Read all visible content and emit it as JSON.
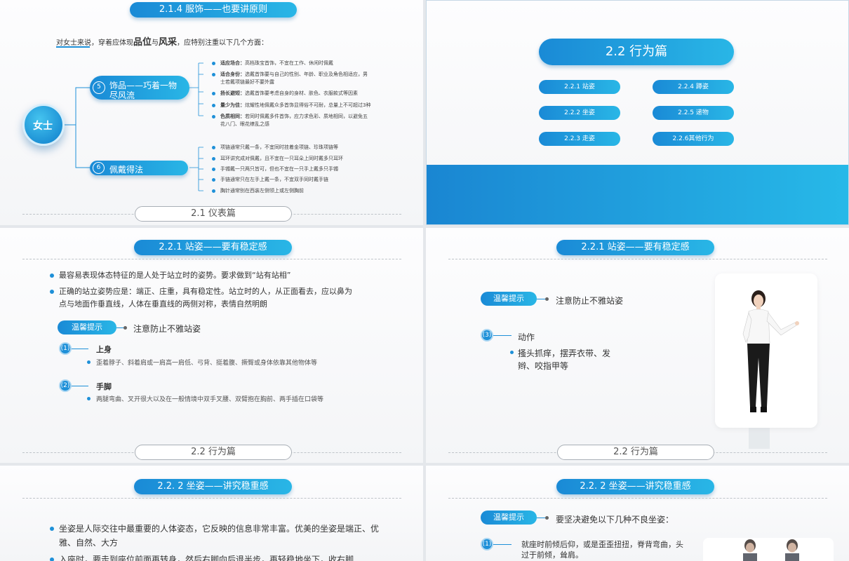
{
  "s1": {
    "title": "2.1.4  服饰——也要讲原则",
    "intro_prefix": "对女士来说，穿着应体现",
    "intro_b1": "品位",
    "intro_mid": "与",
    "intro_b2": "风采",
    "intro_suffix": "，应特别注重以下几个方面：",
    "center": "女士",
    "branch5_num": "5",
    "branch5_l1": "饰品——巧着一物",
    "branch5_l2": "尽风流",
    "branch6_num": "6",
    "branch6_label": "佩戴得法",
    "items_a": [
      {
        "b": "适应场合：",
        "t": "高档珠宝首饰，不宜在工作、休闲时佩戴"
      },
      {
        "b": "适合身份：",
        "t": "选戴首饰要与自己的性别、年龄、职业及角色相适应，男",
        "t2": "士若戴项链最好不要外露"
      },
      {
        "b": "扬长避短：",
        "t": "选戴首饰要考虑自身的身材、肤色、衣服款式等因素"
      },
      {
        "b": "量少为佳：",
        "t": "炫耀性地佩戴众多首饰显得俗不可耐，总量上不可超过3种"
      },
      {
        "b": "色质相同：",
        "t": "若同时佩戴多件首饰，应力求色彩、质地相同，以避免五",
        "t2": "花八门、眼花缭乱之感"
      }
    ],
    "items_b": [
      "项链通常只戴一条，不宜同时挂着金项链、珍珠项链等",
      "耳环讲究成对佩戴，且不宜在一只耳朵上同时戴多只耳环",
      "手镯戴一只两只皆可，但也不宜在一只手上戴多只手镯",
      "手链通常只在左手上戴一条，不宜双手同时戴手链",
      "胸针通常别在西装左侧领上或左侧胸前"
    ],
    "footer": "2.1 仪表篇"
  },
  "s2": {
    "title": "2.2  行为篇",
    "items": [
      "2.2.1  站姿",
      "2.2.4  蹲姿",
      "2.2.2  坐姿",
      "2.2.5  递物",
      "2.2.3  走姿",
      "2.2.6其他行为"
    ]
  },
  "s3": {
    "title": "2.2.1  站姿——要有稳定感",
    "b1": "最容易表现体态特征的是人处于站立时的姿势。要求做到“站有站相”",
    "b2_l1": "正确的站立姿势应是：端正、庄重，具有稳定性。站立时的人，从正面看去，应以鼻为",
    "b2_l2": "点与地面作垂直线，人体在垂直线的两侧对称，表情自然明朗",
    "tip": "温馨提示",
    "tip_text": "注意防止不雅站姿",
    "n1": "(1)",
    "n1_title": "上身",
    "n1_text": "歪着脖子、斜着肩或一肩高一肩低、弓背、挺着腹、撅臀或身体依靠其他物体等",
    "n2": "(2)",
    "n2_title": "手脚",
    "n2_text": "两腿弯曲、叉开很大以及在一般情境中双手叉腰、双臂抱在胸前、两手插在口袋等",
    "footer": "2.2  行为篇"
  },
  "s4": {
    "title": "2.2.1  站姿——要有稳定感",
    "tip": "温馨提示",
    "tip_text": "注意防止不雅站姿",
    "n3": "(3)",
    "n3_title": "动作",
    "n3_l1": "搔头抓痒，摆弄衣带、发",
    "n3_l2": "辫、咬指甲等",
    "footer": "2.2  行为篇"
  },
  "s5": {
    "title": "2.2. 2  坐姿——讲究稳重感",
    "b1_l1": "坐姿是人际交往中最重要的人体姿态，它反映的信息非常丰富。优美的坐姿是端正、优",
    "b1_l2": "雅、自然、大方",
    "b2_l1": "入座时，要走到座位前面再转身，然后右脚向后退半步，再轻稳地坐下，收右脚"
  },
  "s6": {
    "title": "2.2. 2  坐姿——讲究稳重感",
    "tip": "温馨提示",
    "tip_text": "要坚决避免以下几种不良坐姿：",
    "n1": "(1)",
    "n1_l1": "就座时前倾后仰，或是歪歪扭扭，脊背弯曲，头",
    "n1_l2": "过于前倾，耸肩。"
  }
}
